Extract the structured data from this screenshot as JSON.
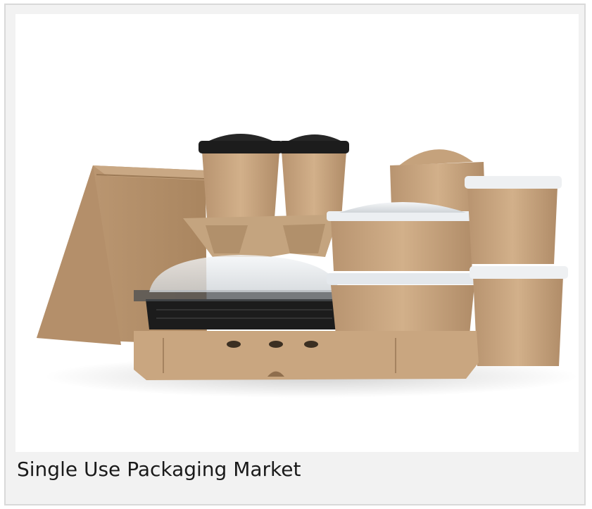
{
  "figure": {
    "caption": "Single Use Packaging Market",
    "image_subject": "kraft paper single-use food packaging: paper bag, coffee cups with black lids, cup carrier, clear-lid bowls, soup containers, black takeaway tray, pizza box, noodle box"
  },
  "colors": {
    "kraft": "#c9a680",
    "kraft_dark": "#a98660",
    "lid_black": "#1c1c1c",
    "clear_lid": "#e6e9ec",
    "frame_bg": "#f2f2f2"
  }
}
